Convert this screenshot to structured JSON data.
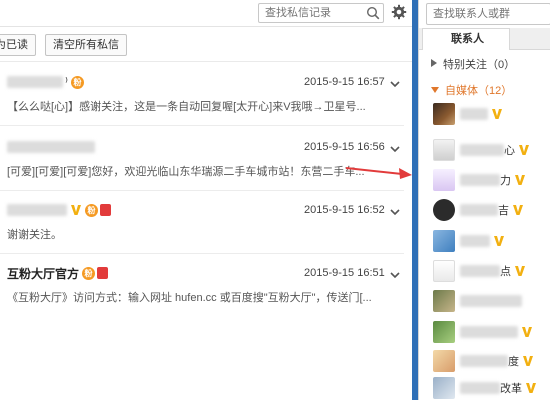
{
  "left": {
    "search_placeholder": "查找私信记录",
    "mark_read_label": "为已读",
    "clear_all_label": "清空所有私信",
    "messages": [
      {
        "sender": "",
        "time": "2015-9-15 16:57",
        "preview": "【么么哒[心]】感谢关注，这是一条自动回复喔[太开心]来V我哦→卫星号..."
      },
      {
        "sender": "",
        "time": "2015-9-15 16:56",
        "preview": "[可爱][可爱][可爱]您好，欢迎光临山东华瑞源二手车城市站！东营二手车..."
      },
      {
        "sender": "",
        "time": "2015-9-15 16:52",
        "preview": "谢谢关注。"
      },
      {
        "sender": "互粉大厅官方",
        "time": "2015-9-15 16:51",
        "preview": "《互粉大厅》访问方式：输入网址 hufen.cc 或百度搜\"互粉大厅\"，传送门[..."
      }
    ]
  },
  "right": {
    "search_placeholder": "查找联系人或群",
    "tab_contacts": "联系人",
    "group_special": "特别关注（0）",
    "group_media": "自媒体（12）",
    "contacts": [
      {
        "name_visible": ""
      },
      {
        "name_visible": "心"
      },
      {
        "name_visible": "力"
      },
      {
        "name_visible": "吉"
      },
      {
        "name_visible": ""
      },
      {
        "name_visible": "点"
      },
      {
        "name_visible": ""
      },
      {
        "name_visible": ""
      },
      {
        "name_visible": "度"
      },
      {
        "name_visible": "改革"
      }
    ]
  },
  "colors": {
    "accent_blue": "#2f6fb6",
    "group_orange": "#e0772b",
    "arrow_red": "#e23b3b",
    "vip_gold": "#f2b011"
  },
  "icons": [
    "search-icon",
    "gear-icon",
    "chevron-down-icon",
    "vip-v-icon",
    "fan-badge-icon",
    "red-tag-icon",
    "triangle-right-icon",
    "triangle-down-icon",
    "red-arrow-icon"
  ]
}
